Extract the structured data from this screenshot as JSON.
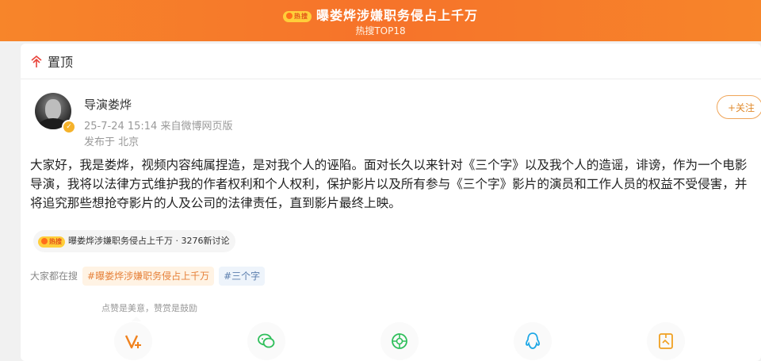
{
  "banner": {
    "hot_tag": "热搜",
    "title": "曝娄烨涉嫌职务侵占上千万",
    "subtitle": "热搜TOP18"
  },
  "pin": {
    "label": "置顶"
  },
  "post": {
    "author": "导演娄烨",
    "meta": "25-7-24 15:14  来自微博网页版",
    "location": "发布于 北京",
    "follow_label": "+关注",
    "body": "大家好，我是娄烨，视频内容纯属捏造，是对我个人的诬陷。面对长久以来针对《三个字》以及我个人的造谣，诽谤，作为一个电影导演，我将以法律方式维护我的作者权利和个人权利，保护影片以及所有参与《三个字》影片的演员和工作人员的权益不受侵害，并将追究那些想抢夺影片的人及公司的法律责任，直到影片最终上映。"
  },
  "topic": {
    "hot_tag": "热搜",
    "text": "曝娄烨涉嫌职务侵占上千万 · 3276新讨论"
  },
  "search": {
    "label": "大家都在搜",
    "chips": [
      "#曝娄烨涉嫌职务侵占上千万",
      "#三个字"
    ]
  },
  "reward_hint": "点赞是美意，赞赏是鼓励",
  "share": {
    "icons": [
      "reward-v-icon",
      "wechat-icon",
      "moments-icon",
      "qq-icon",
      "save-image-icon"
    ]
  },
  "colors": {
    "banner": "#f6732a",
    "accent": "#e8433a",
    "follow": "#e08a2d"
  }
}
